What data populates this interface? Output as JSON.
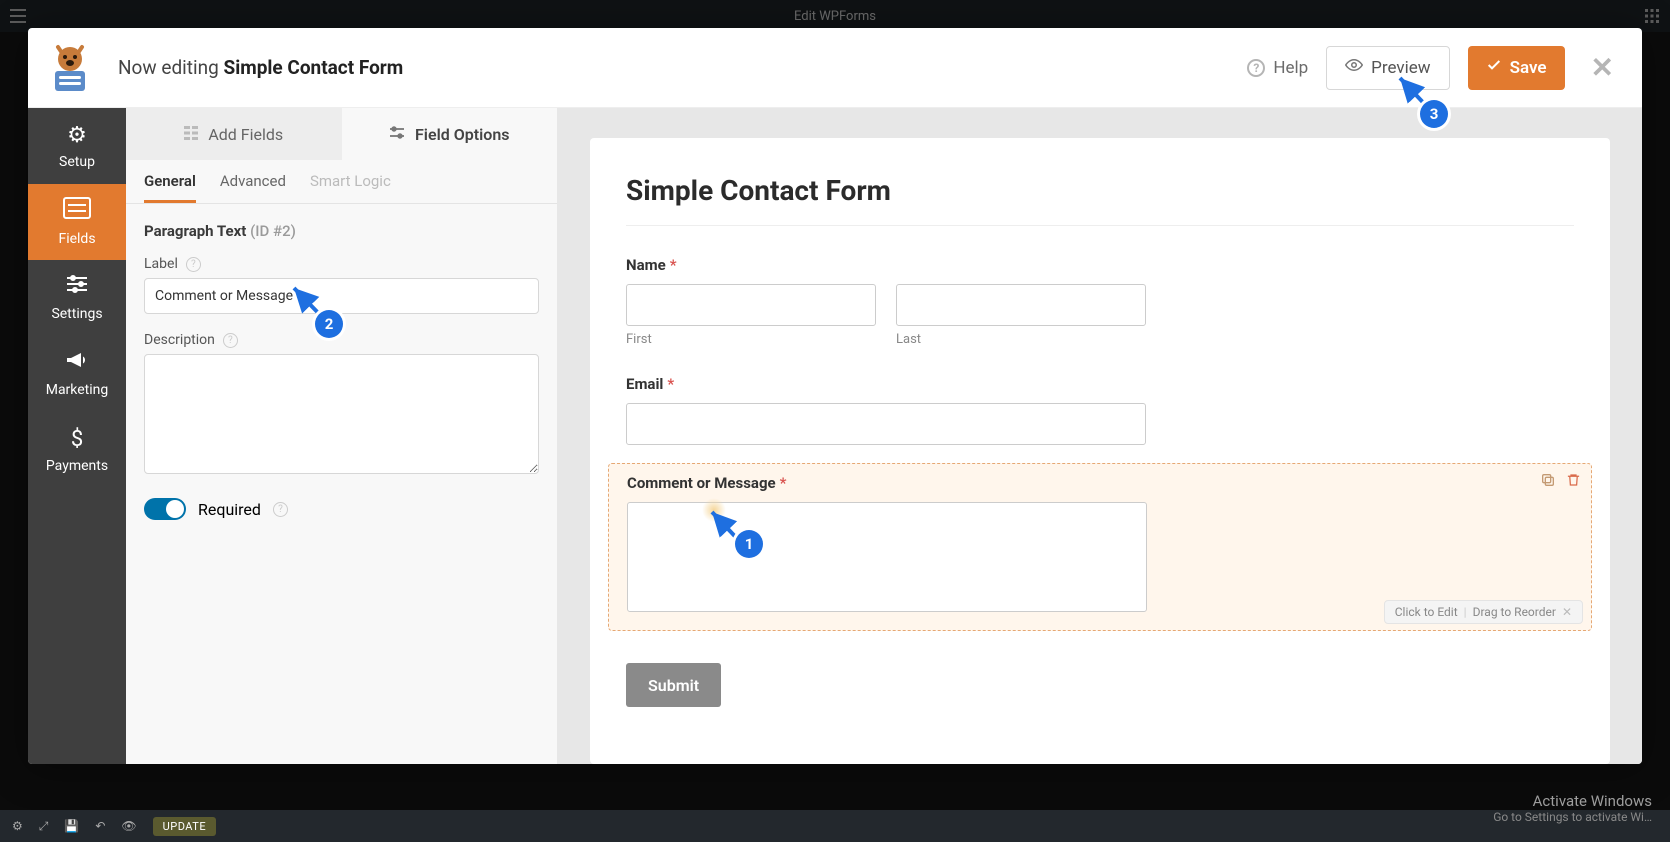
{
  "wp": {
    "topbar_title": "Edit WPForms",
    "update_chip": "UPDATE",
    "watermark_title": "Activate Windows",
    "watermark_sub": "Go to Settings to activate Wi…"
  },
  "header": {
    "editing_prefix": "Now editing",
    "form_name": "Simple Contact Form",
    "help": "Help",
    "preview": "Preview",
    "save": "Save"
  },
  "rail": {
    "setup": "Setup",
    "fields": "Fields",
    "settings": "Settings",
    "marketing": "Marketing",
    "payments": "Payments"
  },
  "config": {
    "tabs": {
      "add": "Add Fields",
      "options": "Field Options"
    },
    "subtabs": {
      "general": "General",
      "advanced": "Advanced",
      "smart": "Smart Logic"
    },
    "panel_title": "Paragraph Text",
    "panel_id": "(ID #2)",
    "label_label": "Label",
    "label_value": "Comment or Message",
    "description_label": "Description",
    "description_value": "",
    "required_label": "Required"
  },
  "preview": {
    "form_title": "Simple Contact Form",
    "name_label": "Name",
    "first_sublabel": "First",
    "last_sublabel": "Last",
    "email_label": "Email",
    "message_label": "Comment or Message",
    "submit": "Submit",
    "hint_edit": "Click to Edit",
    "hint_drag": "Drag to Reorder"
  },
  "annotations": {
    "b1": "1",
    "b2": "2",
    "b3": "3"
  }
}
